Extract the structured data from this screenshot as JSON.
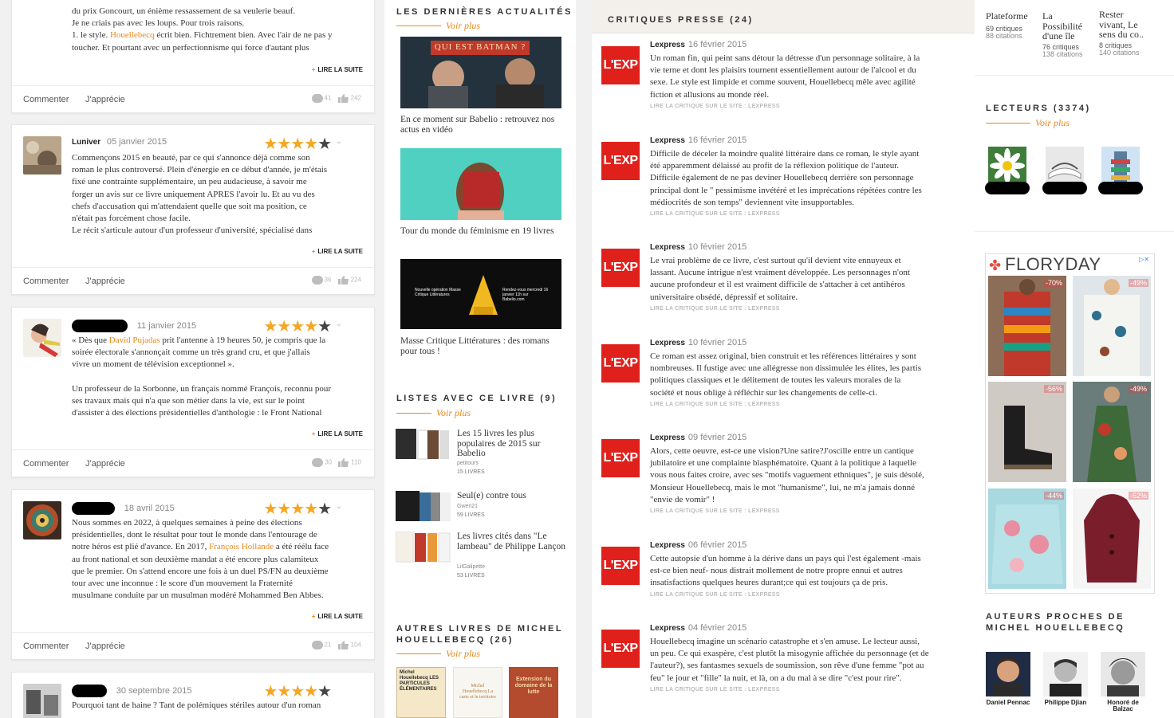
{
  "reviews": [
    {
      "author": "",
      "date": "",
      "lines": [
        "du prix Goncourt, un énième ressassement de sa veulerie beauf.",
        "Je ne criais pas avec les loups. Pour trois raisons."
      ],
      "line3_before": "1. le style. ",
      "line3_highlight": "Houellebecq",
      "line3_after": " écrit bien. Fichtrement bien. Avec l'air de ne pas y",
      "line4": "toucher. Et pourtant avec un perfectionnisme qui force d'autant plus",
      "more": "LIRE LA SUITE",
      "comment": "Commenter",
      "like": "J'apprécie",
      "comments_count": "41",
      "likes_count": "242"
    },
    {
      "author": "Luniver",
      "date": "05 janvier 2015",
      "stars": 4.5,
      "lines": [
        "Commençons 2015 en beauté, par ce qui s'annonce déjà comme son",
        "roman le plus controversé. Plein d'énergie en ce début d'année, je m'étais",
        "fixé une contrainte supplémentaire, un peu audacieuse, à savoir me",
        "forger un avis sur ce livre uniquement APRES l'avoir lu. Et au vu des",
        "chefs d'accusation qui m'attendaient quelle que soit ma position, ce",
        "n'était pas forcément chose facile.",
        "Le récit s'articule autour d'un professeur d'université, spécialisé dans"
      ],
      "more": "LIRE LA SUITE",
      "comment": "Commenter",
      "like": "J'apprécie",
      "comments_count": "36",
      "likes_count": "224"
    },
    {
      "author": "",
      "date": "11 janvier 2015",
      "stars": 4,
      "line1_before": "« Dès que ",
      "line1_highlight": "David Pujadas",
      "line1_after": " prit l'antenne à 19 heures 50, je compris que la",
      "lines": [
        "soirée électorale s'annonçait comme un très grand cru, et que j'allais",
        "vivre un moment de télévision exceptionnel ».",
        "",
        "Un professeur de la Sorbonne, un français nommé François, reconnu pour",
        "ses travaux mais qui n'a que son métier dans la vie, est sur le point",
        "d'assister à des élections présidentielles d'anthologie : le Front National"
      ],
      "more": "LIRE LA SUITE",
      "comment": "Commenter",
      "like": "J'apprécie",
      "comments_count": "30",
      "likes_count": "110"
    },
    {
      "author": "",
      "date": "18 avril 2015",
      "stars": 4,
      "lines_a": [
        "Nous sommes en 2022, à quelques semaines à peine des élections",
        "présidentielles, dont le résultat pour tout le monde dans l'entourage de"
      ],
      "line3_before": "notre héros est plié d'avance. En 2017, ",
      "line3_highlight": "François Hollande",
      "line3_after": " a été réélu face",
      "lines_b": [
        "au front national et son deuxième mandat a été encore plus calamiteux",
        "que le premier. On s'attend encore une fois à un duel PS/FN au deuxième",
        "tour avec une inconnue : le score d'un mouvement la Fraternité",
        "musulmane conduite par un musulman modéré Mohammed Ben Abbes."
      ],
      "more": "LIRE LA SUITE",
      "comment": "Commenter",
      "like": "J'apprécie",
      "comments_count": "21",
      "likes_count": "104"
    },
    {
      "author": "",
      "date": "30 septembre 2015",
      "stars": 4,
      "lines": [
        "Pourquoi tant de haine ? Tant de polémiques stériles autour d'un roman"
      ]
    }
  ],
  "news": {
    "title": "LES DERNIÈRES ACTUALITÉS",
    "voir": "Voir plus",
    "items": [
      {
        "banner": "QUI EST BATMAN ?",
        "caption": "En ce moment sur Babelio : retrouvez nos actus en vidéo"
      },
      {
        "caption": "Tour du monde du féminisme en 19 livres"
      },
      {
        "banner_left": "Nouvelle opération Masse Critique Littératures",
        "banner_right": "Rendez-vous mercredi 16 janvier 11h sur Babelio.com",
        "caption": "Masse Critique Littératures : des romans pour tous !"
      }
    ]
  },
  "lists": {
    "title": "LISTES AVEC CE LIVRE (9)",
    "voir": "Voir plus",
    "items": [
      {
        "title": "Les 15 livres les plus populaires de 2015 sur Babelio",
        "author": "petitours",
        "count": "15 LIVRES"
      },
      {
        "title": "Seul(e) contre tous",
        "author": "Gwen21",
        "count": "59 LIVRES"
      },
      {
        "title": "Les livres cités dans \"Le lambeau\" de Philippe Lançon",
        "author": "LilGalipette",
        "count": "53 LIVRES"
      }
    ]
  },
  "other_books": {
    "title_line1": "AUTRES LIVRES DE MICHEL",
    "title_line2": "HOUELLEBECQ (26)",
    "voir": "Voir plus",
    "covers": [
      {
        "text": "Michel Houellebecq LES PARTICULES ÉLÉMENTAIRES"
      },
      {
        "text": "Michel Houellebecq La carte et le territoire"
      },
      {
        "text": "Extension du domaine de la lutte"
      }
    ]
  },
  "press": {
    "title": "CRITIQUES PRESSE (24)",
    "logo": "L'EXP",
    "link": "LIRE LA CRITIQUE SUR LE SITE : LEXPRESS",
    "items": [
      {
        "name": "Lexpress",
        "date": "16 février 2015",
        "lines": [
          "Un roman fin, qui peint sans détour la détresse d'un personnage solitaire, à la",
          "vie terne et dont les plaisirs tournent essentiellement autour de l'alcool et du",
          "sexe. Le style est limpide et comme souvent, Houellebecq mêle avec agilité",
          "fiction et allusions au monde réel."
        ]
      },
      {
        "name": "Lexpress",
        "date": "16 février 2015",
        "lines": [
          "Difficile de déceler la moindre qualité littéraire dans ce roman, le style ayant",
          "été apparemment délaissé au profit de la réflexion politique de l'auteur.",
          "Difficile également de ne pas deviner Houellebecq derrière son personnage",
          "principal dont le \" pessimisme invétéré et les imprécations répétées contre les",
          "médiocrités de son temps\" deviennent vite insupportables."
        ]
      },
      {
        "name": "Lexpress",
        "date": "10 février 2015",
        "lines": [
          "Le vrai problème de ce livre, c'est surtout qu'il devient vite ennuyeux et",
          "lassant. Aucune intrigue n'est vraiment développée. Les personnages n'ont",
          "aucune profondeur et il est vraiment difficile de s'attacher à cet antihéros",
          "universitaire obsédé, dépressif et solitaire."
        ]
      },
      {
        "name": "Lexpress",
        "date": "10 février 2015",
        "lines": [
          "Ce roman est assez original, bien construit et les références littéraires y sont",
          "nombreuses. Il fustige avec une allégresse non dissimulée les élites, les partis",
          "politiques classiques et le délitement de toutes les valeurs morales de la",
          "société et nous oblige à réfléchir sur les changements de celle-ci."
        ]
      },
      {
        "name": "Lexpress",
        "date": "09 février 2015",
        "lines": [
          "Alors, cette oeuvre, est-ce une vision?Une satire?J'oscille entre un cantique",
          "jubilatoire et une complainte blasphématoire. Quant à la politique à laquelle",
          "vous nous faites croire, avec ses \"motifs vaguement ethniques\", je suis désolé,",
          "Monsieur Houellebecq, mais le mot \"humanisme\", lui, ne m'a jamais donné",
          "\"envie de vomir\" !"
        ]
      },
      {
        "name": "Lexpress",
        "date": "06 février 2015",
        "lines": [
          "Cette autopsie d'un homme à la dérive dans un pays qui l'est également -mais",
          "est-ce bien neuf- nous distrait mollement de notre propre ennui et autres",
          "insatisfactions quelques heures durant;ce qui est toujours ça de pris."
        ]
      },
      {
        "name": "Lexpress",
        "date": "04 février 2015",
        "lines": [
          "Houellebecq imagine un scénario catastrophe et s'en amuse. Le lecteur aussi,",
          "un peu. Ce qui exaspère, c'est plutôt la misogynie affichée du personnage (et de",
          "l'auteur?), ses fantasmes sexuels de soumission, son rêve d'une femme \"pot au",
          "feu\" le jour et \"fille\" la nuit, et là, on a du mal à se dire \"c'est pour rire\"."
        ]
      }
    ]
  },
  "sidebar": {
    "top_items": [
      {
        "title": [
          "Plateforme"
        ],
        "c1": "69 critiques",
        "c2": "88 citations"
      },
      {
        "title": [
          "La",
          "Possibilité",
          "d'une île"
        ],
        "c1": "76 critiques",
        "c2": "138 citations"
      },
      {
        "title": [
          "Rester",
          "vivant, Le",
          "sens du co.."
        ],
        "c1": "8 critiques",
        "c2": "140 citations"
      }
    ],
    "readers_title": "LECTEURS (3374)",
    "readers_voir": "Voir plus",
    "ad": {
      "brand": "FLORYDAY",
      "discounts": [
        "-70%",
        "-49%",
        "-56%",
        "-49%",
        "-44%",
        "-52%"
      ]
    },
    "authors_title_line1": "AUTEURS PROCHES DE",
    "authors_title_line2": "MICHEL HOUELLEBECQ",
    "authors": [
      {
        "name_line1": "Daniel Pennac",
        "name_line2": ""
      },
      {
        "name_line1": "Philippe Djian",
        "name_line2": ""
      },
      {
        "name_line1": "Honoré de",
        "name_line2": "Balzac"
      }
    ]
  }
}
